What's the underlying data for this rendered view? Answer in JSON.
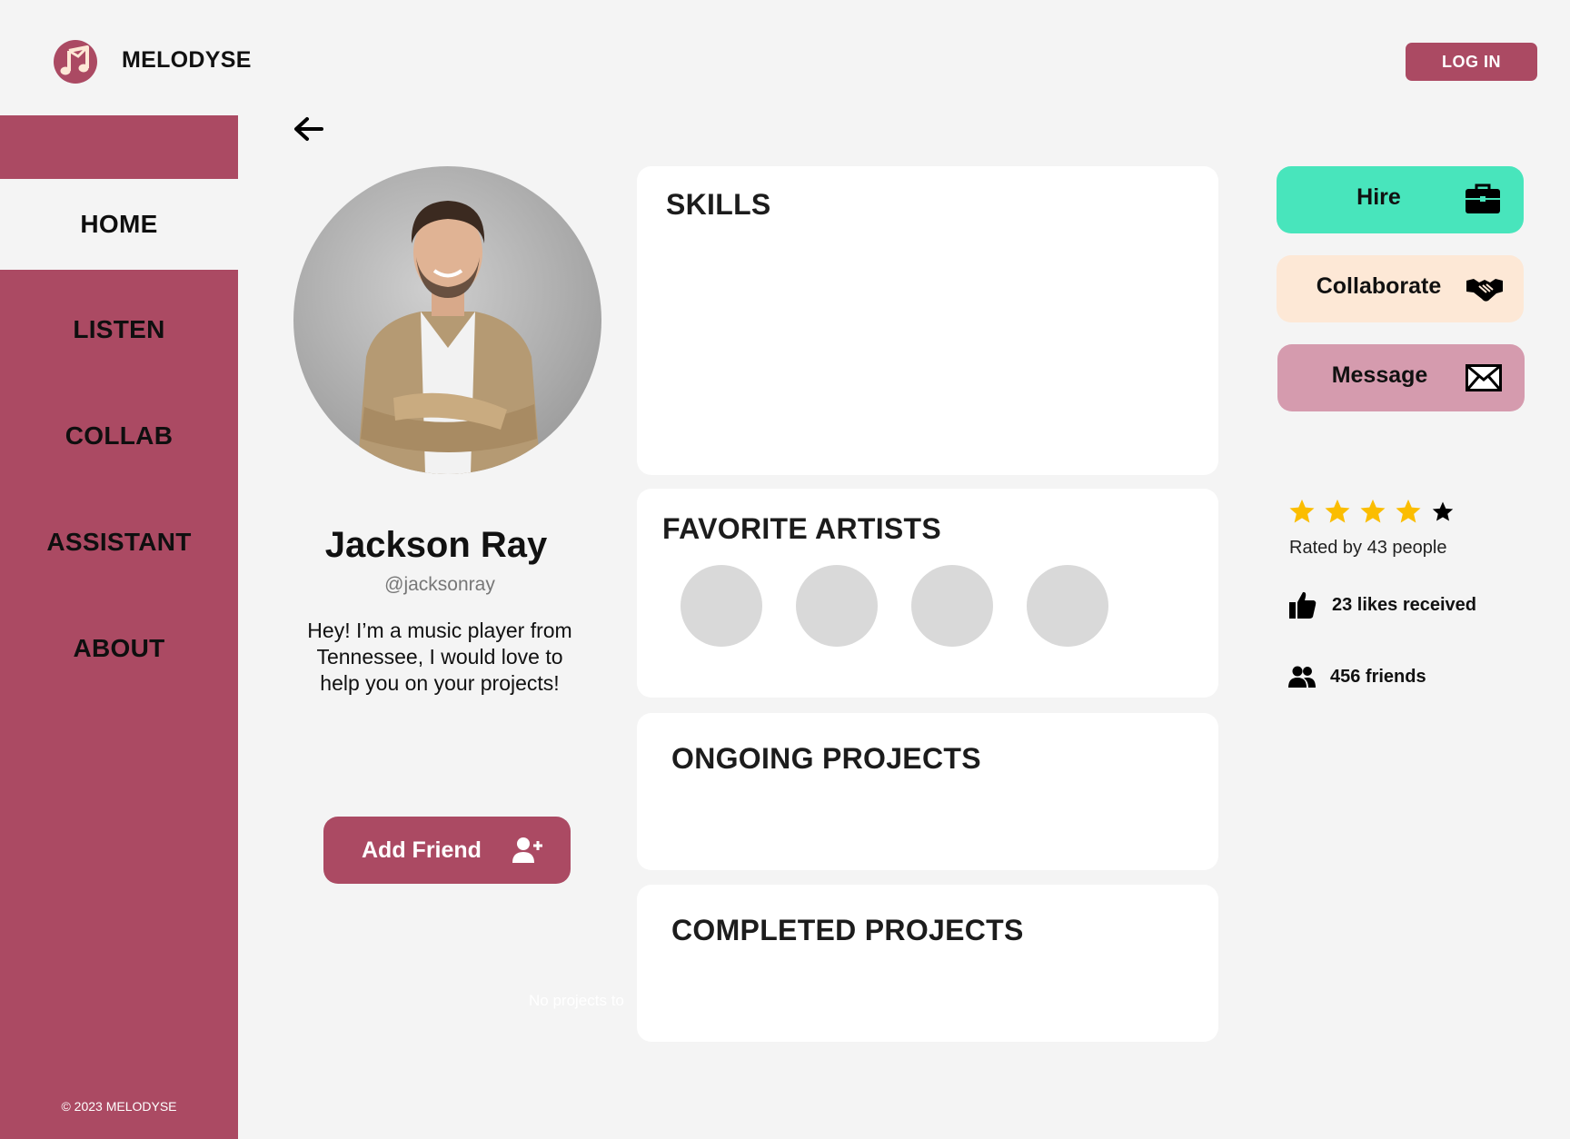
{
  "brand": {
    "name": "MELODYSE",
    "logo_icon": "music-note-icon",
    "color": "#ab4a63"
  },
  "header": {
    "login_label": "LOG IN"
  },
  "sidebar": {
    "items": [
      {
        "label": "HOME",
        "active": true
      },
      {
        "label": "LISTEN",
        "active": false
      },
      {
        "label": "COLLAB",
        "active": false
      },
      {
        "label": "ASSISTANT",
        "active": false
      },
      {
        "label": "ABOUT",
        "active": false
      }
    ],
    "copyright": "© 2023 MELODYSE"
  },
  "profile": {
    "name": "Jackson Ray",
    "handle": "@jacksonray",
    "bio": "Hey! I’m a music player from Tennessee, I would love to help you on your projects!",
    "add_friend_label": "Add Friend",
    "faint_text": "No projects to"
  },
  "sections": {
    "skills_title": "SKILLS",
    "favorite_artists_title": "FAVORITE ARTISTS",
    "ongoing_title": "ONGOING PROJECTS",
    "completed_title": "COMPLETED PROJECTS"
  },
  "actions": [
    {
      "label": "Hire",
      "icon": "briefcase-icon",
      "color": "#48e5bc"
    },
    {
      "label": "Collaborate",
      "icon": "handshake-icon",
      "color": "#fde8d6"
    },
    {
      "label": "Message",
      "icon": "envelope-icon",
      "color": "#d59bae"
    }
  ],
  "stats": {
    "rating": {
      "value": 4,
      "max": 5
    },
    "rated_by": "Rated by 43 people",
    "likes": "23 likes received",
    "friends": "456 friends"
  },
  "colors": {
    "accent": "#ab4a63",
    "background": "#f4f4f4",
    "star": "#fbbd00"
  }
}
